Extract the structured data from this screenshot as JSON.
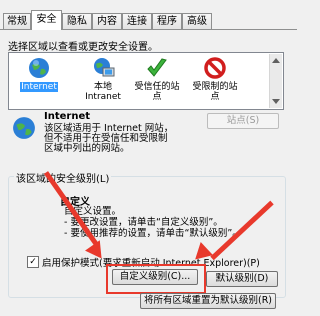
{
  "tabs": [
    {
      "label": "常规"
    },
    {
      "label": "安全"
    },
    {
      "label": "隐私"
    },
    {
      "label": "内容"
    },
    {
      "label": "连接"
    },
    {
      "label": "程序"
    },
    {
      "label": "高级"
    }
  ],
  "active_tab": "安全",
  "zone_prompt": "选择区域以查看或更改安全设置。",
  "zones": [
    {
      "label": "Internet",
      "icon": "globe-icon",
      "selected": true
    },
    {
      "label": "本地\nIntranet",
      "icon": "intranet-icon"
    },
    {
      "label": "受信任的站\n点",
      "icon": "checkmark-icon"
    },
    {
      "label": "受限制的站\n点",
      "icon": "restricted-icon"
    }
  ],
  "zone_info": {
    "title": "Internet",
    "description": "该区域适用于 Internet 网站，但不适用于在受信任和受限制区域中列出的网站。"
  },
  "sites_button": "站点(S)",
  "security_group": {
    "title": "该区域的安全级别(L)",
    "level_title": "自定义",
    "lines": [
      "自定义设置。",
      "- 要更改设置，请单击“自定义级别”。",
      "- 要使用推荐的设置，请单击“默认级别”。"
    ],
    "partial_text": "xplorer)"
  },
  "protected_mode": {
    "label": "启用保护模式(要求重新启动 Internet Explorer)(P)",
    "checked": true
  },
  "buttons": {
    "custom_level": "自定义级别(C)...",
    "default_level": "默认级别(D)",
    "reset_all": "将所有区域重置为默认级别(R)"
  },
  "colors": {
    "arrow": "#e8392c",
    "highlight": "#e8392c",
    "selection": "#3399ff"
  }
}
